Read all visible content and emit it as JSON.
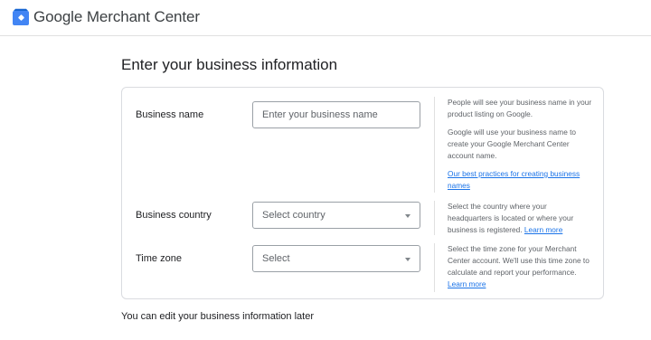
{
  "header": {
    "app_title": "Google Merchant Center",
    "logo_icon": "merchant-center-logo-icon",
    "brand_color": "#4285f4"
  },
  "page": {
    "title": "Enter your business information",
    "footer_note": "You can edit your business information later"
  },
  "form": {
    "business_name": {
      "label": "Business name",
      "placeholder": "Enter your business name",
      "value": "",
      "help_1": "People will see your business name in your product listing on Google.",
      "help_2": "Google will use your business name to create your Google Merchant Center account name.",
      "help_link": "Our best practices for creating business names"
    },
    "business_country": {
      "label": "Business country",
      "selected": "Select country",
      "help": "Select the country where your headquarters is located or where your business is registered.",
      "help_link": "Learn more"
    },
    "time_zone": {
      "label": "Time zone",
      "selected": "Select",
      "help": "Select the time zone for your Merchant Center account. We'll use this time zone to calculate and report your performance.",
      "help_link": "Learn more"
    }
  },
  "colors": {
    "link": "#1a73e8",
    "border": "#dadce0",
    "field_border": "#9aa0a6",
    "help_text": "#5f6368"
  }
}
